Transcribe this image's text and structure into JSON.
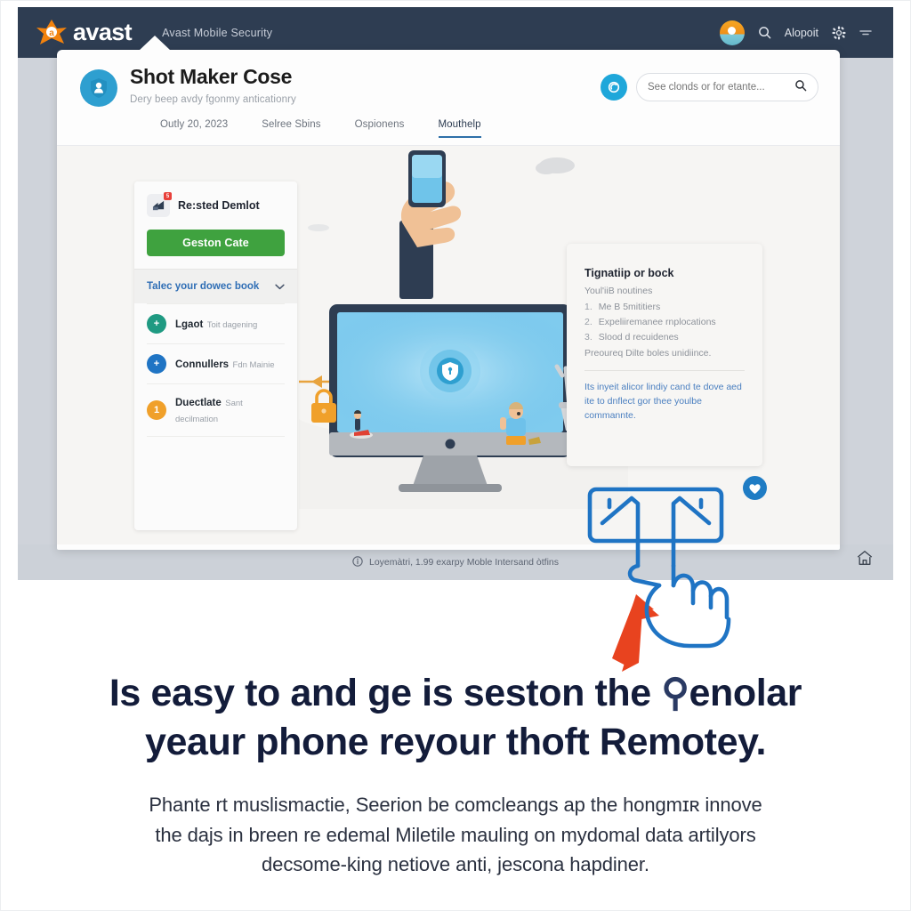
{
  "header": {
    "brand": "avast",
    "app_name": "Avast Mobile Security",
    "right_label": "Alopoit",
    "icons": {
      "avatar": "user-avatar",
      "search": "search-icon",
      "settings": "gear-icon",
      "dropdown": "chevron-down-icon"
    },
    "colors": {
      "bar": "#2e3d52",
      "brand_orange": "#f2820d"
    }
  },
  "card": {
    "title": "Shot Maker Cose",
    "subtitle": "Dery beep avdy fgonmy anticationry",
    "search_placeholder": "See clonds or for etante...",
    "search_value": "",
    "tabs": [
      {
        "label": "Outly 20, 2023",
        "active": false
      },
      {
        "label": "Selree Sbins",
        "active": false
      },
      {
        "label": "Ospionens",
        "active": false
      },
      {
        "label": "Mouthelp",
        "active": true
      }
    ]
  },
  "left_panel": {
    "app_name": "Re:sted Demlot",
    "badge": "5",
    "cta_label": "Geston Cate",
    "cta_color": "#3fa23f",
    "link_label": "Talec your dowec book",
    "items": [
      {
        "title": "Lgaot",
        "sub": "Toit dagening",
        "mark": "+",
        "color": "#1f9a82"
      },
      {
        "title": "Connullers",
        "sub": "Fdn Mainie",
        "mark": "+",
        "color": "#1f74c4"
      },
      {
        "title": "Duectlate",
        "sub": "Sant decilmation",
        "mark": "1",
        "color": "#f0a02a"
      }
    ]
  },
  "right_panel": {
    "title": "Tignatiip or bock",
    "lead": "Youl'iiB noutines",
    "list": [
      {
        "num": "1.",
        "text": "Me B 5mititiers"
      },
      {
        "num": "2.",
        "text": "Expeliiremanee rnplocations"
      },
      {
        "num": "3.",
        "text": "Slood d recuidenes"
      }
    ],
    "after": "Preoureq Dilte boles unidiince.",
    "blue_text": "Its inyeit alicor lindiy cand te dove aed ite to dnflect gor thee youlbe commannte."
  },
  "browser_footer": {
    "text": "Loyemàtri, 1.99 exarpy Moble Intersand òtfins",
    "info_icon": "info-icon",
    "corner_icon": "home-icon"
  },
  "overlay": {
    "hand_icon": "tap-hand-icon",
    "arrow_icon": "up-arrow-icon",
    "heart_badge_icon": "heart-icon",
    "arrow_color": "#e8431f",
    "hand_color": "#1f74c4"
  },
  "bottom": {
    "headline_line1": "Is easy to and ge is seston the ",
    "headline_glyph": "⚲",
    "headline_line1_end": "enolar",
    "headline_line2": "yeaur phone reyour thoft Remotey.",
    "body_line1": "Phante rt muslismactie, Seerion be comcleangs ap the hongmɪʀ innove",
    "body_line2": "the dajs in breen re edemal Miletile mauling on mydomal data artilyors",
    "body_line3": "decsome-king netiove anti, jescona hapdiner."
  }
}
